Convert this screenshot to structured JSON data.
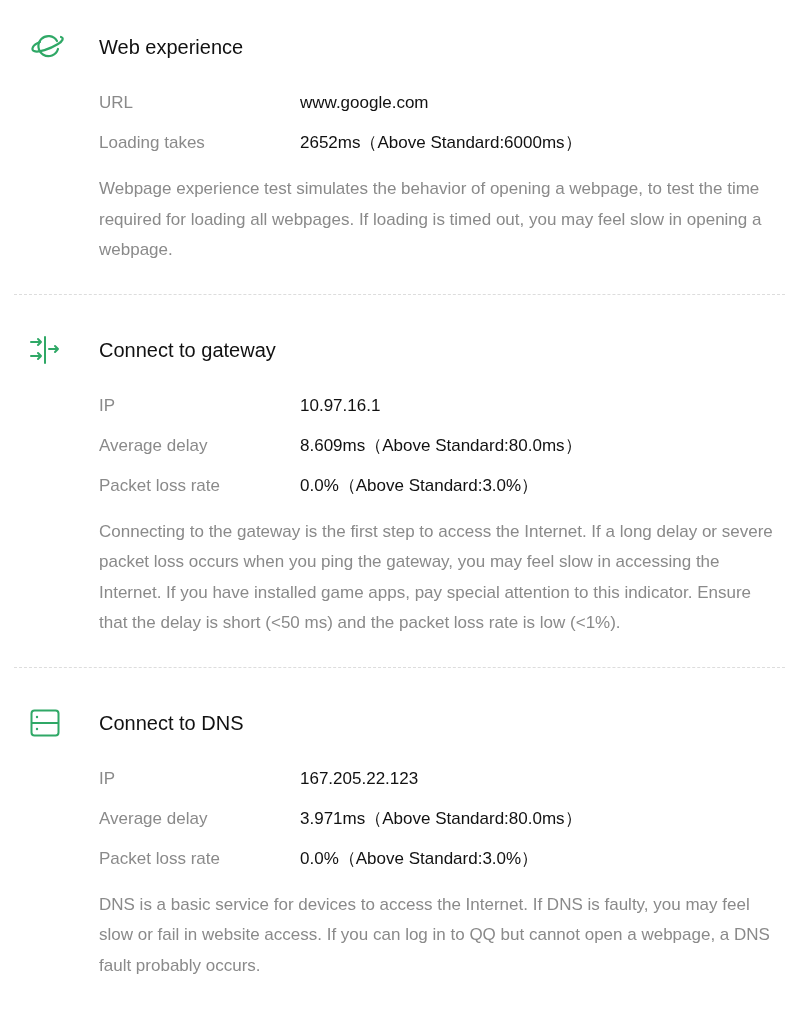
{
  "sections": [
    {
      "kind": "planet",
      "title": "Web experience",
      "rows": [
        {
          "label": "URL",
          "value": "www.google.com"
        },
        {
          "label": "Loading takes",
          "value": "2652ms（Above Standard:6000ms）"
        }
      ],
      "description": "Webpage experience test simulates the behavior of opening a webpage, to test the time required for loading all webpages. If loading is timed out, you may feel slow in opening a webpage."
    },
    {
      "kind": "gateway",
      "title": "Connect to gateway",
      "rows": [
        {
          "label": "IP",
          "value": "10.97.16.1"
        },
        {
          "label": "Average delay",
          "value": "8.609ms（Above Standard:80.0ms）"
        },
        {
          "label": "Packet loss rate",
          "value": "0.0%（Above Standard:3.0%）"
        }
      ],
      "description": "Connecting to the gateway is the first step to access the Internet. If a long delay or severe packet loss occurs when you ping the gateway, you may feel slow in accessing the Internet. If you have installed game apps, pay special attention to this indicator. Ensure that the delay is short (<50 ms) and the packet loss rate is low (<1%)."
    },
    {
      "kind": "server",
      "title": "Connect to DNS",
      "rows": [
        {
          "label": "IP",
          "value": "167.205.22.123"
        },
        {
          "label": "Average delay",
          "value": "3.971ms（Above Standard:80.0ms）"
        },
        {
          "label": "Packet loss rate",
          "value": "0.0%（Above Standard:3.0%）"
        }
      ],
      "description": "DNS is a basic service for devices to access the Internet. If DNS is faulty, you may feel slow or fail in website access. If you can log in to QQ but cannot open a webpage, a DNS fault probably occurs."
    }
  ]
}
